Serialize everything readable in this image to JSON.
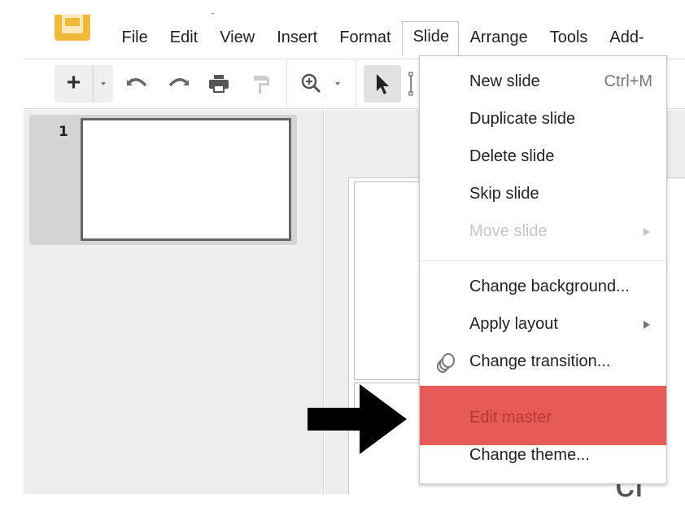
{
  "app": {
    "logo_icon": "google-slides-logo-icon",
    "colors": {
      "logo": "#f1b93a",
      "highlight": "#e65b58",
      "highlight_text": "#b93632"
    }
  },
  "menubar": {
    "items": [
      {
        "label": "File"
      },
      {
        "label": "Edit"
      },
      {
        "label": "View"
      },
      {
        "label": "Insert"
      },
      {
        "label": "Format"
      },
      {
        "label": "Slide",
        "open": true
      },
      {
        "label": "Arrange"
      },
      {
        "label": "Tools"
      },
      {
        "label": "Add-"
      }
    ]
  },
  "toolbar": {
    "new_slide": "+",
    "icons": [
      "plus-icon",
      "chevron-down-icon",
      "undo-icon",
      "redo-icon",
      "print-icon",
      "paint-format-icon",
      "zoom-icon",
      "chevron-down-icon",
      "select-cursor-icon",
      "text-box-icon"
    ]
  },
  "filmstrip": {
    "slides": [
      {
        "number": "1"
      }
    ]
  },
  "canvas": {
    "cut_text": "cl"
  },
  "slide_menu": {
    "items": [
      {
        "label": "New slide",
        "shortcut": "Ctrl+M"
      },
      {
        "label": "Duplicate slide"
      },
      {
        "label": "Delete slide"
      },
      {
        "label": "Skip slide"
      },
      {
        "label": "Move slide",
        "disabled": true,
        "submenu": true
      },
      {
        "label": "Change background..."
      },
      {
        "label": "Apply layout",
        "submenu": true
      },
      {
        "label": "Change transition...",
        "icon": "transition-icon"
      },
      {
        "label": "Edit master",
        "highlighted": true
      },
      {
        "label": "Change theme..."
      }
    ]
  },
  "annotation": {
    "arrow_icon": "right-arrow-annotation-icon",
    "points_to": "Edit master"
  }
}
